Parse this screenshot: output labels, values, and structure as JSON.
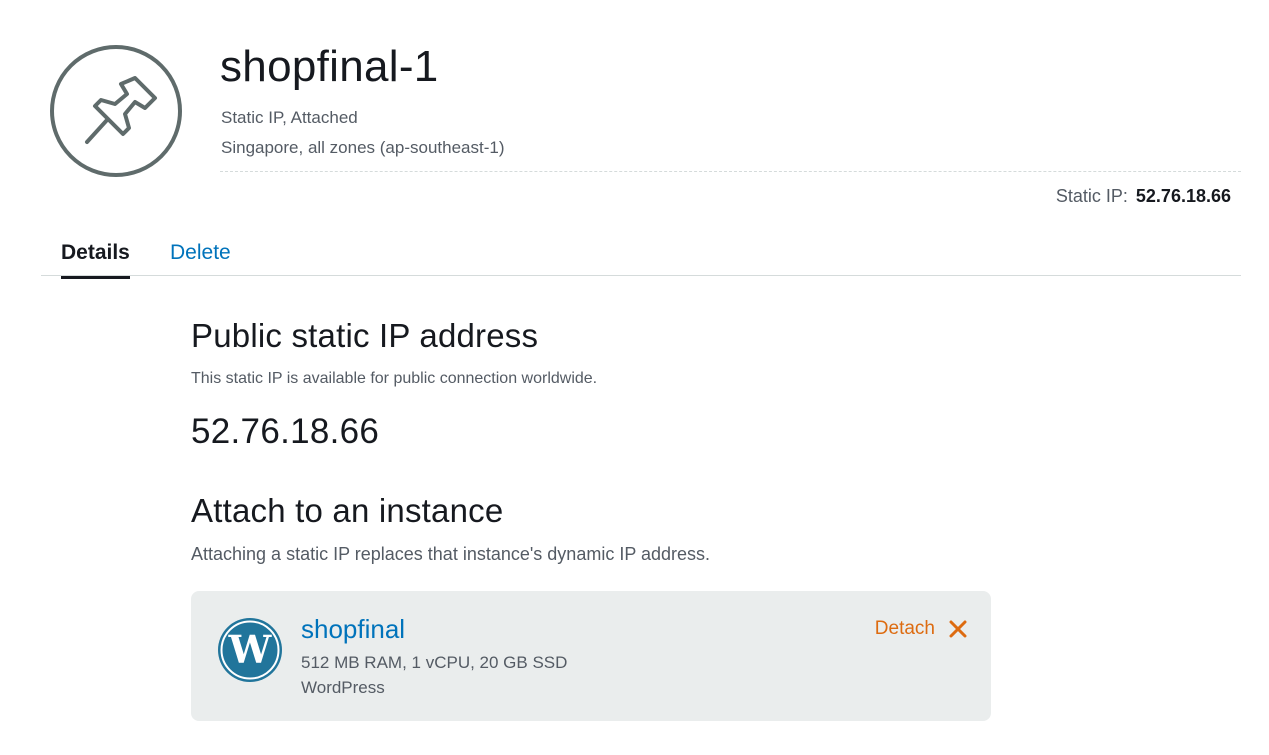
{
  "header": {
    "title": "shopfinal-1",
    "status": "Static IP, Attached",
    "location": "Singapore, all zones (ap-southeast-1)",
    "static_ip_label": "Static IP:",
    "static_ip_value": "52.76.18.66",
    "icon": "pin-icon"
  },
  "tabs": [
    {
      "label": "Details",
      "active": true
    },
    {
      "label": "Delete",
      "active": false
    }
  ],
  "public_ip": {
    "title": "Public static IP address",
    "description": "This static IP is available for public connection worldwide.",
    "value": "52.76.18.66"
  },
  "attach": {
    "title": "Attach to an instance",
    "description": "Attaching a static IP replaces that instance's dynamic IP address.",
    "instance": {
      "name": "shopfinal",
      "specs": "512 MB RAM, 1 vCPU, 20 GB SSD",
      "blueprint": "WordPress",
      "icon": "wordpress-icon",
      "detach_label": "Detach"
    }
  },
  "colors": {
    "link": "#0073bb",
    "action": "#dd6b10",
    "card_bg": "#eaeded",
    "icon_gray": "#5f6b6b"
  }
}
